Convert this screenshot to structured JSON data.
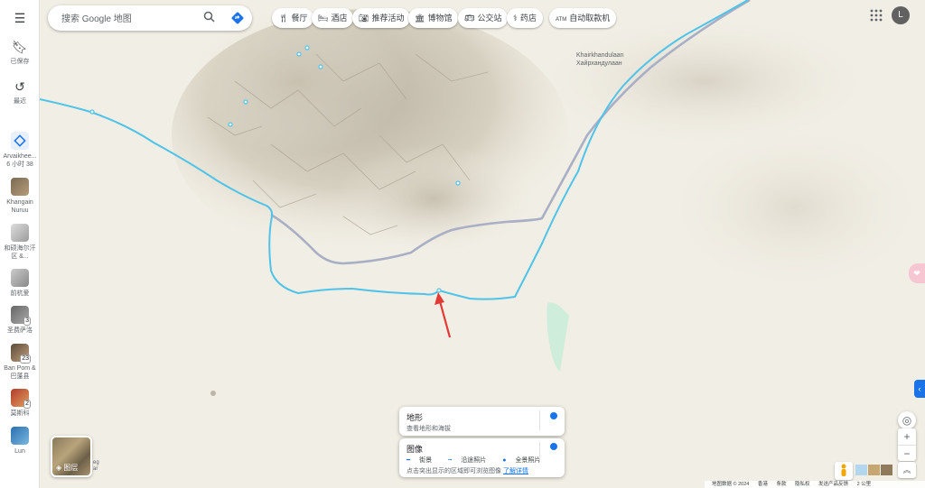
{
  "search": {
    "placeholder": "搜索 Google 地图"
  },
  "rail": {
    "saved_label": "已保存",
    "recent_label": "最近",
    "items": [
      {
        "label1": "Arvaikhee...",
        "label2": "6 小时 38"
      },
      {
        "label1": "Khangain",
        "label2": "Nuruu"
      },
      {
        "label1": "和硕海尔汗",
        "label2": "区 &..."
      },
      {
        "label1": "前杭爱",
        "label2": ""
      },
      {
        "label1": "圣费萨洛",
        "label2": "",
        "badge": "3"
      },
      {
        "label1": "Ban Pom &",
        "label2": "巴蓬县",
        "badge": "23"
      },
      {
        "label1": "莫斯科",
        "label2": "",
        "badge": "2"
      },
      {
        "label1": "Lun",
        "label2": ""
      }
    ]
  },
  "chips": [
    "餐厅",
    "酒店",
    "推荐活动",
    "博物馆",
    "公交站",
    "药店",
    "自动取款机"
  ],
  "chip_icons": [
    "fork-knife-icon",
    "bed-icon",
    "camera-icon",
    "museum-icon",
    "bus-icon",
    "pharmacy-icon",
    "atm-icon"
  ],
  "user": {
    "avatar_initial": "L"
  },
  "map": {
    "place_label_en": "Khairkhandulaan",
    "place_label_mn": "Хайрхандулаан",
    "thumbnail_fragment_1": "eg",
    "thumbnail_fragment_2": "ar"
  },
  "layers_button_label": "图层",
  "terrain_card": {
    "title": "地形",
    "desc": "查看地形和海拔"
  },
  "imagery_card": {
    "title": "图像",
    "legend_street": "街景",
    "legend_photos": "沿途照片",
    "legend_pano": "全景照片",
    "desc": "点击突出显示的区域即可浏览图像",
    "link": "了解详情"
  },
  "status_bar": {
    "copyright": "地图数据 © 2024",
    "region": "香港",
    "terms": "条款",
    "privacy": "隐私权",
    "feedback": "发送产品反馈",
    "scale": "2 公里"
  },
  "colors": {
    "accent": "#1a73e8",
    "route": "#4fc3e8",
    "road": "#a9afc4"
  }
}
